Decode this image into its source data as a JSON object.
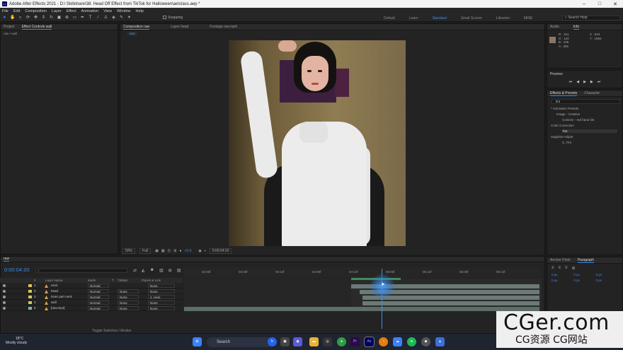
{
  "app": {
    "title": "Adobe After Effects 2021 - D:\\ Skillshare\\38. Head Off Effect from TikTok for Halloween\\ae\\class.aep *",
    "icon_label": "Ae"
  },
  "menu": [
    "File",
    "Edit",
    "Composition",
    "Layer",
    "Effect",
    "Animation",
    "View",
    "Window",
    "Help"
  ],
  "toolbar": {
    "snapping_label": "Snapping"
  },
  "workspaces": [
    {
      "label": "Default",
      "active": false
    },
    {
      "label": "Learn",
      "active": false
    },
    {
      "label": "Standard",
      "active": true
    },
    {
      "label": "Small Screen",
      "active": false
    },
    {
      "label": "Libraries",
      "active": false
    },
    {
      "label": "MINE",
      "active": false
    }
  ],
  "help_search": {
    "placeholder": "Search Help"
  },
  "left_panel": {
    "tabs": [
      "Project",
      "Effect Controls wall"
    ],
    "subtitle": "raw • wall"
  },
  "comp_panel": {
    "tabs": [
      "Composition raw",
      "Layer head",
      "Footage raw.mp4"
    ],
    "subtab": "raw"
  },
  "viewer_bar": {
    "zoom": "50%",
    "quality": "Full",
    "exposure": "+0.0",
    "timecode": "0:00:04:20"
  },
  "info_panel": {
    "tabs": [
      "Audio",
      "Info"
    ],
    "readout_left": [
      "R : 151",
      "G : 120",
      "B : 105",
      "A : 255"
    ],
    "readout_right": [
      "X : 834",
      "Y : 1684"
    ]
  },
  "preview_panel": {
    "title": "Preview"
  },
  "effects_panel": {
    "tabs": [
      "Effects & Presets",
      "Character"
    ],
    "search_value": "tint",
    "tree": [
      {
        "label": "* Animation Presets",
        "level": 0,
        "highlight": false
      },
      {
        "label": "Image - Creative",
        "level": 1,
        "highlight": false
      },
      {
        "label": "Colorize - red hand tint",
        "level": 2,
        "highlight": false
      },
      {
        "label": "Color Correction",
        "level": 0,
        "highlight": false
      },
      {
        "label": "Tint",
        "level": 2,
        "highlight": true
      },
      {
        "label": "Sapphire Adjust",
        "level": 0,
        "highlight": false
      },
      {
        "label": "S_Tint",
        "level": 2,
        "highlight": false
      }
    ]
  },
  "timeline": {
    "tab": "raw",
    "timecode": "0:00:04:20",
    "columns": [
      "#",
      "Layer Name",
      "Mode",
      "T",
      "TrkMat",
      "Parent & Link"
    ],
    "ruler_ticks": [
      "02:00f",
      "03:00f",
      "03:12f",
      "04:00f",
      "04:12f",
      "05:00f",
      "05:12f",
      "06:00f",
      "06:12f"
    ],
    "layers": [
      {
        "num": "1",
        "name": "neck",
        "mode": "Normal",
        "trkmat": "",
        "parent": "None",
        "label_color": "#d9c45b"
      },
      {
        "num": "2",
        "name": "head",
        "mode": "Normal",
        "trkmat": "None",
        "parent": "None",
        "label_color": "#d9c45b"
      },
      {
        "num": "3",
        "name": "inner part neck",
        "mode": "Normal",
        "trkmat": "None",
        "parent": "1. neck",
        "label_color": "#d9c45b"
      },
      {
        "num": "4",
        "name": "wall",
        "mode": "Normal",
        "trkmat": "None",
        "parent": "None",
        "label_color": "#d9c45b"
      },
      {
        "num": "5",
        "name": "[raw.mp4]",
        "mode": "Normal",
        "trkmat": "None",
        "parent": "None",
        "label_color": "#7ab8a8"
      }
    ],
    "toggle_label": "Toggle Switches / Modes"
  },
  "right_bottom": {
    "tabs": [
      "Anchor Point",
      "Paragraph"
    ],
    "values": [
      "0 px",
      "0 px",
      "0 px",
      "0 px",
      "0 px",
      "0 px"
    ]
  },
  "taskbar": {
    "weather_temp": "18°C",
    "weather_desc": "Mostly cloudy",
    "search_placeholder": "Search",
    "apps": [
      "start-icon",
      "search-icon",
      "bing-icon",
      "files-icon",
      "chat-icon",
      "explorer-icon",
      "media-icon",
      "chrome-icon",
      "premiere-icon",
      "aftereffects-icon",
      "blender-icon",
      "onedrive-icon",
      "spotify-icon",
      "app-icon",
      "app2-icon"
    ]
  },
  "watermark": {
    "line1": "CGer.com",
    "line2": "CG资源 CG网站"
  }
}
